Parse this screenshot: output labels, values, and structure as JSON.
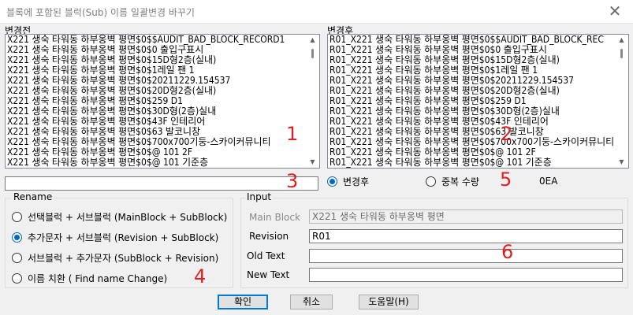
{
  "window": {
    "title": "블록에 포함된 블럭(Sub) 이름 일괄변경 바꾸기",
    "close_glyph": "✕"
  },
  "before_list": {
    "label": "변경전",
    "items": [
      "X221 생숙 타워동 하부옹벽 평면$0$$AUDIT_BAD_BLOCK_RECORD1",
      "X221 생숙 타워동 하부옹벽 평면$0$0 출입구표시",
      "X221 생숙 타워동 하부옹벽 평면$0$15D형2층(실내)",
      "X221 생숙 타워동 하부옹벽 평면$0$1레일 팬 1",
      "X221 생숙 타워동 하부옹벽 평면$0$20211229.154537",
      "X221 생숙 타워동 하부옹벽 평면$0$20D형2층(실내)",
      "X221 생숙 타워동 하부옹벽 평면$0$259 D1",
      "X221 생숙 타워동 하부옹벽 평면$0$30D형(2층)실내",
      "X221 생숙 타워동 하부옹벽 평면$0$43F 인테리어",
      "X221 생숙 타워동 하부옹벽 평면$0$63 발코니창",
      "X221 생숙 타워동 하부옹벽 평면$0$700x700기둥-스카이커뮤니티",
      "X221 생숙 타워동 하부옹벽 평면$0$@ 101 2F",
      "X221 생숙 타워동 하부옹벽 평면$0$@ 101 기준층",
      "X221 생숙 타워동 하부옹벽 평면$0$@ 101 옥탑1층"
    ]
  },
  "after_list": {
    "label": "변경후",
    "items": [
      "R01_X221 생숙 타워동 하부옹벽 평면$0$$AUDIT_BAD_BLOCK_REC",
      "R01_X221 생숙 타워동 하부옹벽 평면$0$0 출입구표시",
      "R01_X221 생숙 타워동 하부옹벽 평면$0$15D형2층(실내)",
      "R01_X221 생숙 타워동 하부옹벽 평면$0$1레일 팬 1",
      "R01_X221 생숙 타워동 하부옹벽 평면$0$20211229.154537",
      "R01_X221 생숙 타워동 하부옹벽 평면$0$20D형2층(실내)",
      "R01_X221 생숙 타워동 하부옹벽 평면$0$259 D1",
      "R01_X221 생숙 타워동 하부옹벽 평면$0$30D형(2층)실내",
      "R01_X221 생숙 타워동 하부옹벽 평면$0$43F 인테리어",
      "R01_X221 생숙 타워동 하부옹벽 평면$0$63 발코니창",
      "R01_X221 생숙 타워동 하부옹벽 평면$0$700x700기둥-스카이커뮤니티",
      "R01_X221 생숙 타워동 하부옹벽 평면$0$@ 101 2F",
      "R01_X221 생숙 타워동 하부옹벽 평면$0$@ 101 기준층",
      "R01_X221 생숙 타워동 하부옹벽 평면$0$@ 101 옥탑1층"
    ]
  },
  "filter": {
    "value": "",
    "view_after_label": "변경후",
    "view_duplicate_label": "중복 수량",
    "count": "0EA",
    "selected": "변경후"
  },
  "rename": {
    "title": "Rename",
    "options": [
      "선택블럭 + 서브블럭 (MainBlock + SubBlock)",
      "추가문자 + 서브블럭 (Revision + SubBlock)",
      "서브블럭 + 추가문자 (SubBlock + Revision)",
      "이름 치환 ( Find name Change)"
    ],
    "selected_index": 1
  },
  "input": {
    "title": "Input",
    "main_block_label": "Main Block",
    "main_block_value": "X221 생숙 타워동 하부옹벽 평면",
    "revision_label": "Revision",
    "revision_value": "R01",
    "old_text_label": "Old Text",
    "old_text_value": "",
    "new_text_label": "New Text",
    "new_text_value": ""
  },
  "buttons": {
    "ok": "확인",
    "cancel": "취소",
    "help": "도움말(H)"
  },
  "annotations": [
    "1",
    "2",
    "3",
    "4",
    "5",
    "6"
  ],
  "colors": {
    "annotation": "#e02020",
    "accent": "#0067c0"
  }
}
